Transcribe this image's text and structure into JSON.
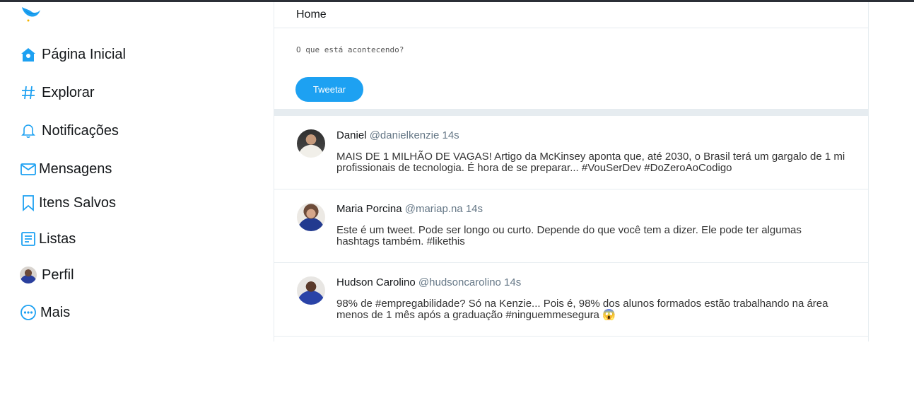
{
  "nav": {
    "items": [
      {
        "label": "Página Inicial",
        "icon": "home-icon"
      },
      {
        "label": "Explorar",
        "icon": "hashtag-icon"
      },
      {
        "label": "Notificações",
        "icon": "bell-icon"
      },
      {
        "label": "Mensagens",
        "icon": "mail-icon"
      },
      {
        "label": "Itens Salvos",
        "icon": "bookmark-icon"
      },
      {
        "label": "Listas",
        "icon": "list-icon"
      },
      {
        "label": "Perfil",
        "icon": "avatar"
      },
      {
        "label": "Mais",
        "icon": "more-icon"
      }
    ]
  },
  "header": {
    "title": "Home"
  },
  "compose": {
    "placeholder": "O que está acontecendo?",
    "button_label": "Tweetar"
  },
  "tweets": [
    {
      "name": "Daniel",
      "handle": "@danielkenzie",
      "time": "14s",
      "text": "MAIS DE 1 MILHÃO DE VAGAS! Artigo da McKinsey aponta que, até 2030, o Brasil terá um gargalo de 1 mi profissionais de tecnologia. É hora de se preparar... #VouSerDev #DoZeroAoCodigo"
    },
    {
      "name": "Maria Porcina",
      "handle": "@mariap.na",
      "time": "14s",
      "text": "Este é um tweet. Pode ser longo ou curto. Depende do que você tem a dizer. Ele pode ter algumas hashtags também. #likethis"
    },
    {
      "name": "Hudson Carolino",
      "handle": "@hudsoncarolino",
      "time": "14s",
      "text": "98% de #empregabilidade? Só na Kenzie... Pois é, 98% dos alunos formados estão trabalhando na área menos de 1 mês após a graduação #ninguemmesegura 😱"
    }
  ],
  "colors": {
    "accent": "#1da1f2",
    "divider": "#e6ecf0"
  }
}
